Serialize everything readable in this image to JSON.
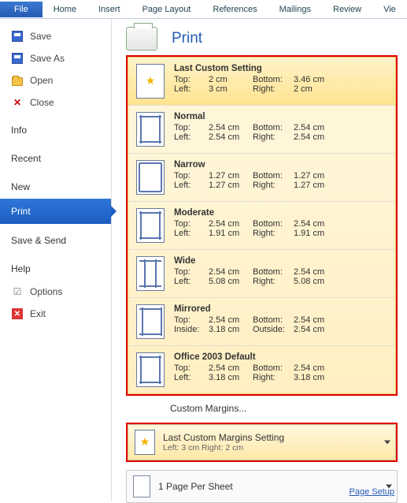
{
  "ribbon": [
    "File",
    "Home",
    "Insert",
    "Page Layout",
    "References",
    "Mailings",
    "Review",
    "Vie"
  ],
  "left": {
    "save": "Save",
    "saveAs": "Save As",
    "open": "Open",
    "close": "Close",
    "info": "Info",
    "recent": "Recent",
    "new": "New",
    "print": "Print",
    "saveSend": "Save & Send",
    "help": "Help",
    "options": "Options",
    "exit": "Exit"
  },
  "print": {
    "title": "Print"
  },
  "margins": {
    "options": [
      {
        "name": "Last Custom Setting",
        "l1k": "Top:",
        "l1v": "2 cm",
        "r1k": "Bottom:",
        "r1v": "3.46 cm",
        "l2k": "Left:",
        "l2v": "3 cm",
        "r2k": "Right:",
        "r2v": "2 cm",
        "icon": "star",
        "sel": true
      },
      {
        "name": "Normal",
        "l1k": "Top:",
        "l1v": "2.54 cm",
        "r1k": "Bottom:",
        "r1v": "2.54 cm",
        "l2k": "Left:",
        "l2v": "2.54 cm",
        "r2k": "Right:",
        "r2v": "2.54 cm",
        "icon": "normal"
      },
      {
        "name": "Narrow",
        "l1k": "Top:",
        "l1v": "1.27 cm",
        "r1k": "Bottom:",
        "r1v": "1.27 cm",
        "l2k": "Left:",
        "l2v": "1.27 cm",
        "r2k": "Right:",
        "r2v": "1.27 cm",
        "icon": "narrow"
      },
      {
        "name": "Moderate",
        "l1k": "Top:",
        "l1v": "2.54 cm",
        "r1k": "Bottom:",
        "r1v": "2.54 cm",
        "l2k": "Left:",
        "l2v": "1.91 cm",
        "r2k": "Right:",
        "r2v": "1.91 cm",
        "icon": "normal"
      },
      {
        "name": "Wide",
        "l1k": "Top:",
        "l1v": "2.54 cm",
        "r1k": "Bottom:",
        "r1v": "2.54 cm",
        "l2k": "Left:",
        "l2v": "5.08 cm",
        "r2k": "Right:",
        "r2v": "5.08 cm",
        "icon": "wide"
      },
      {
        "name": "Mirrored",
        "l1k": "Top:",
        "l1v": "2.54 cm",
        "r1k": "Bottom:",
        "r1v": "2.54 cm",
        "l2k": "Inside:",
        "l2v": "3.18 cm",
        "r2k": "Outside:",
        "r2v": "2.54 cm",
        "icon": "mirror"
      },
      {
        "name": "Office 2003 Default",
        "l1k": "Top:",
        "l1v": "2.54 cm",
        "r1k": "Bottom:",
        "r1v": "2.54 cm",
        "l2k": "Left:",
        "l2v": "3.18 cm",
        "r2k": "Right:",
        "r2v": "3.18 cm",
        "icon": "normal"
      }
    ],
    "customLink": "Custom Margins..."
  },
  "dropdowns": {
    "margins": {
      "title": "Last Custom Margins Setting",
      "sub": "Left: 3 cm   Right: 2 cm"
    },
    "pages": {
      "title": "1 Page Per Sheet"
    }
  },
  "pageSetup": "Page Setup"
}
